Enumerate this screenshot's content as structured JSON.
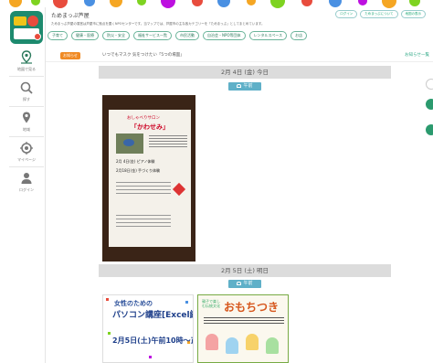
{
  "header": {
    "title": "ためまっぷ芦屋",
    "description": "ためまっぷ芦屋の運営は芦屋市に拠点を置くNPOセンターです。当マップでは、芦屋市の主な各カテゴリーを「ためまっぷ」としてまとめています。",
    "buttons": [
      "ログイン",
      "ためまっぷについて",
      "地図の表示"
    ]
  },
  "tags": [
    "子育て",
    "健康・医療",
    "防災・安全",
    "福祉サービス一覧",
    "市民活動",
    "自治会・NPO等団体",
    "レンタルスペース",
    "お店"
  ],
  "sidebar": {
    "items": [
      {
        "label": "地図で見る",
        "icon": "map-pin-icon"
      },
      {
        "label": "探す",
        "icon": "search-icon"
      },
      {
        "label": "地域",
        "icon": "location-icon"
      },
      {
        "label": "マイページ",
        "icon": "target-icon"
      },
      {
        "label": "ログイン",
        "icon": "user-icon"
      }
    ]
  },
  "news": {
    "badge": "お知らせ",
    "text": "いつでもマスク 気をつけたい「5つの場面」",
    "link": "お知らせ一覧"
  },
  "days": [
    {
      "date": "2月 4日 (金) 今日",
      "time_of_day": "午前"
    },
    {
      "date": "2月 5日 (土) 明日",
      "time_of_day": "午前"
    }
  ],
  "flyers": {
    "f1": {
      "line1": "おしゃべりサロン",
      "line2": "「かわせみ」",
      "row1": "2月 4日(金)  ピアノ体験",
      "row2": "2月18日(金)  手づくり体験"
    },
    "f2": {
      "line1": "女性のための",
      "line2": "パソコン講座[Excel編]",
      "line3": "2月5日(土)午前10時〜正午"
    },
    "f3": {
      "line1": "親子で楽しむ伝統文化",
      "line2": "おもちつき"
    }
  },
  "colors": {
    "accent": "#2b7a5c",
    "badge": "#f08a24",
    "time_tag": "#5fb0c8",
    "date_bar": "#dcdcdc"
  }
}
